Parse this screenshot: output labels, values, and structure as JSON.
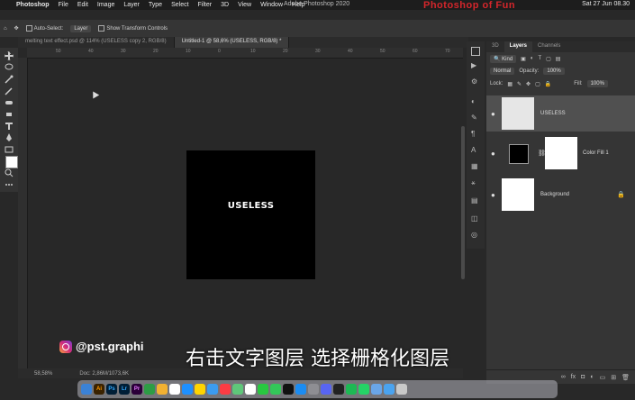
{
  "menubar": {
    "app_name": "Photoshop",
    "items": [
      "File",
      "Edit",
      "Image",
      "Layer",
      "Type",
      "Select",
      "Filter",
      "3D",
      "View",
      "Window",
      "Help"
    ],
    "window_title": "Adobe Photoshop 2020",
    "clock": "Sat 27 Jun  08.30",
    "watermark": "Photoshop of Fun"
  },
  "options_bar": {
    "auto_select_label": "Auto-Select:",
    "auto_select_value": "Layer",
    "transform_label": "Show Transform Controls"
  },
  "doc_tabs": [
    {
      "label": "melting text effect.psd @ 114% (USELESS copy 2, RGB/8)"
    },
    {
      "label": "Untitled-1 @ 58,6% (USELESS, RGB/8) *"
    }
  ],
  "ruler": {
    "ticks": [
      "50",
      "40",
      "30",
      "20",
      "10",
      "0",
      "10",
      "20",
      "30",
      "40",
      "50",
      "60",
      "70"
    ]
  },
  "canvas": {
    "text": "USELESS"
  },
  "status": {
    "zoom": "58,58%",
    "doc": "Doc: 2,86M/1073,6K"
  },
  "layers_panel": {
    "tabs": [
      "3D",
      "Layers",
      "Channels"
    ],
    "filter_label": "Kind",
    "blend_mode": "Normal",
    "opacity_label": "Opacity:",
    "opacity_value": "100%",
    "lock_label": "Lock:",
    "fill_label": "Fill:",
    "fill_value": "100%",
    "layers": [
      {
        "name": "USELESS",
        "selected": true
      },
      {
        "name": "Color Fill 1",
        "selected": false
      },
      {
        "name": "Background",
        "selected": false
      }
    ]
  },
  "overlay": {
    "social_handle": "@pst.graphi",
    "subtitle": "右击文字图层 选择栅格化图层"
  },
  "colors": {
    "accent": "#d4262b",
    "panel": "#353535",
    "background": "#282828"
  },
  "dock_apps": [
    "Finder",
    "Ai",
    "Ps",
    "Lr",
    "Pr",
    "Chrome",
    "Photos",
    "Calendar",
    "Safari",
    "Notes",
    "Mail",
    "Music",
    "Maps",
    "Reminders",
    "FaceTime",
    "Messages",
    "TV",
    "App Store",
    "System Prefs",
    "Discord",
    "Terminal",
    "Spotify",
    "WhatsApp",
    "Preview",
    "Folder",
    "Trash"
  ]
}
